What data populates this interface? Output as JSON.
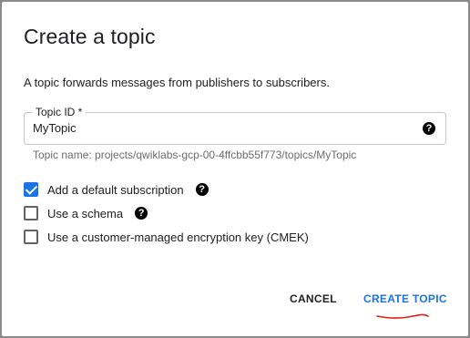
{
  "dialog": {
    "title": "Create a topic",
    "description": "A topic forwards messages from publishers to subscribers."
  },
  "topic_field": {
    "label": "Topic ID *",
    "value": "MyTopic",
    "help_icon": "help-icon",
    "hint": "Topic name: projects/qwiklabs-gcp-00-4ffcbb55f773/topics/MyTopic"
  },
  "options": [
    {
      "label": "Add a default subscription",
      "checked": true,
      "has_help": true
    },
    {
      "label": "Use a schema",
      "checked": false,
      "has_help": true
    },
    {
      "label": "Use a customer-managed encryption key (CMEK)",
      "checked": false,
      "has_help": false
    }
  ],
  "actions": {
    "cancel_label": "CANCEL",
    "create_label": "CREATE TOPIC"
  },
  "colors": {
    "primary": "#1a73e8",
    "annotation": "#e0201c",
    "backdrop": "#8a8a8a"
  }
}
